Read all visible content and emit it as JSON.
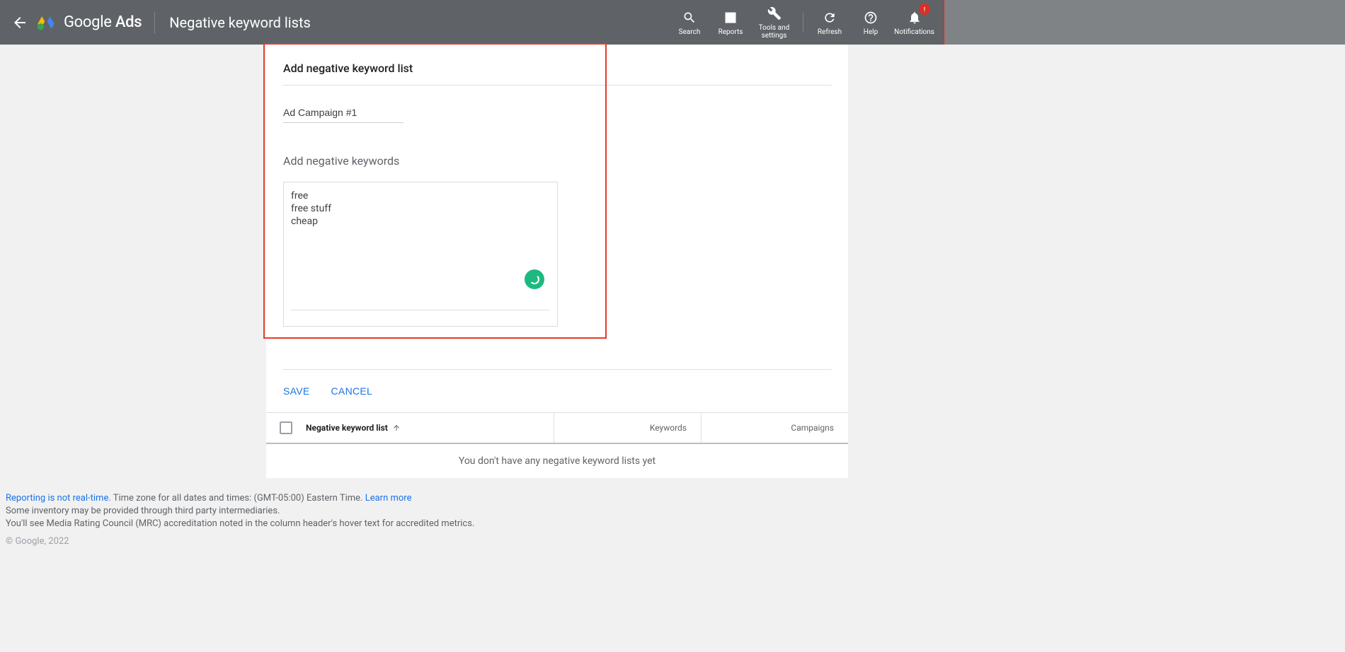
{
  "header": {
    "brand_part1": "Google",
    "brand_part2": "Ads",
    "page_title": "Negative keyword lists",
    "actions": {
      "search": "Search",
      "reports": "Reports",
      "tools": "Tools and settings",
      "refresh": "Refresh",
      "help": "Help",
      "notifications": "Notifications",
      "badge": "!"
    }
  },
  "form": {
    "title": "Add negative keyword list",
    "list_name_value": "Ad Campaign #1",
    "section_title": "Add negative keywords",
    "keywords_text": "free\nfree stuff\ncheap",
    "save_label": "SAVE",
    "cancel_label": "CANCEL"
  },
  "table": {
    "col_name": "Negative keyword list",
    "col_keywords": "Keywords",
    "col_campaigns": "Campaigns",
    "empty_message": "You don't have any negative keyword lists yet"
  },
  "footer": {
    "line1_link1": "Reporting is not real-time.",
    "line1_text": " Time zone for all dates and times: (GMT-05:00) Eastern Time. ",
    "line1_link2": "Learn more",
    "line2": "Some inventory may be provided through third party intermediaries.",
    "line3": "You'll see Media Rating Council (MRC) accreditation noted in the column header's hover text for accredited metrics.",
    "copyright": "© Google, 2022"
  }
}
